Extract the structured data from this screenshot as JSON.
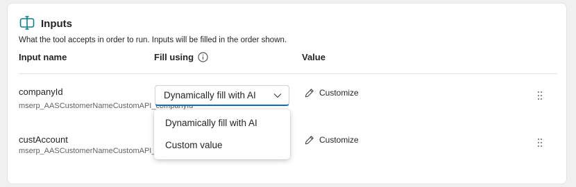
{
  "section": {
    "title": "Inputs",
    "description": "What the tool accepts in order to run. Inputs will be filled in the order shown.",
    "icon": "input-panel-icon"
  },
  "columns": {
    "input_name": "Input name",
    "fill_using": "Fill using",
    "value": "Value"
  },
  "rows": [
    {
      "name": "companyId",
      "sub": "mserp_AASCustomerNameCustomAPI_companyId",
      "fill": "Dynamically fill with AI",
      "customize_label": "Customize"
    },
    {
      "name": "custAccount",
      "sub": "mserp_AASCustomerNameCustomAPI_custAccount",
      "fill": "Dynamically fill with AI",
      "customize_label": "Customize"
    }
  ],
  "dropdown": {
    "options": [
      "Dynamically fill with AI",
      "Custom value"
    ]
  },
  "colors": {
    "accent": "#0f6cbd",
    "icon_teal": "#0f7c8a"
  }
}
